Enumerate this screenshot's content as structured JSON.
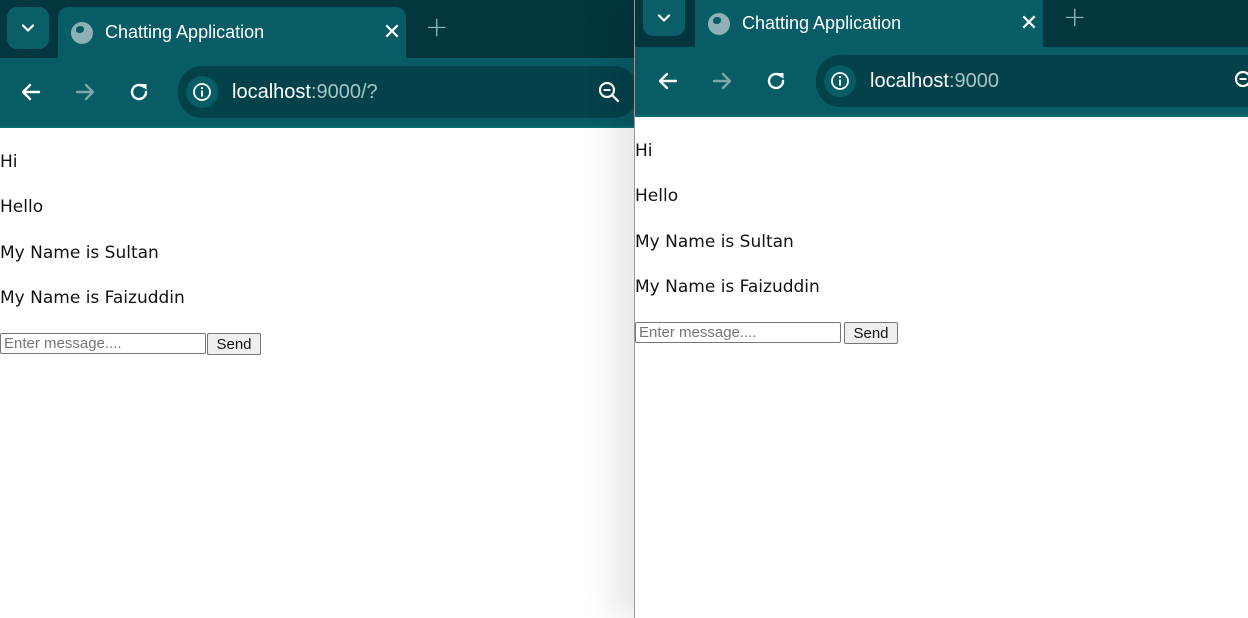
{
  "windows": [
    {
      "id": "left",
      "tab": {
        "title": "Chatting Application"
      },
      "address": {
        "host": "localhost",
        "rest": ":9000/?"
      },
      "messages": [
        "Hi",
        "Hello",
        "My Name is Sultan",
        "My Name is Faizuddin"
      ],
      "composer": {
        "placeholder": "Enter message....",
        "send_label": "Send"
      }
    },
    {
      "id": "right",
      "tab": {
        "title": "Chatting Application"
      },
      "address": {
        "host": "localhost",
        "rest": ":9000"
      },
      "messages": [
        "Hi",
        "Hello",
        "My Name is Sultan",
        "My Name is Faizuddin"
      ],
      "composer": {
        "placeholder": "Enter message....",
        "send_label": "Send"
      }
    }
  ],
  "icons": {
    "tab_search": "chevron-down-icon",
    "favicon": "globe-icon",
    "close": "close-icon",
    "new_tab": "plus-icon",
    "back": "arrow-left-icon",
    "forward": "arrow-right-icon",
    "reload": "reload-icon",
    "site_info": "info-icon",
    "zoom": "zoom-out-icon"
  },
  "colors": {
    "tab_strip": "#03363f",
    "toolbar": "#075c66",
    "omnibox": "#03424b",
    "url_dim": "#a7c3c7"
  }
}
